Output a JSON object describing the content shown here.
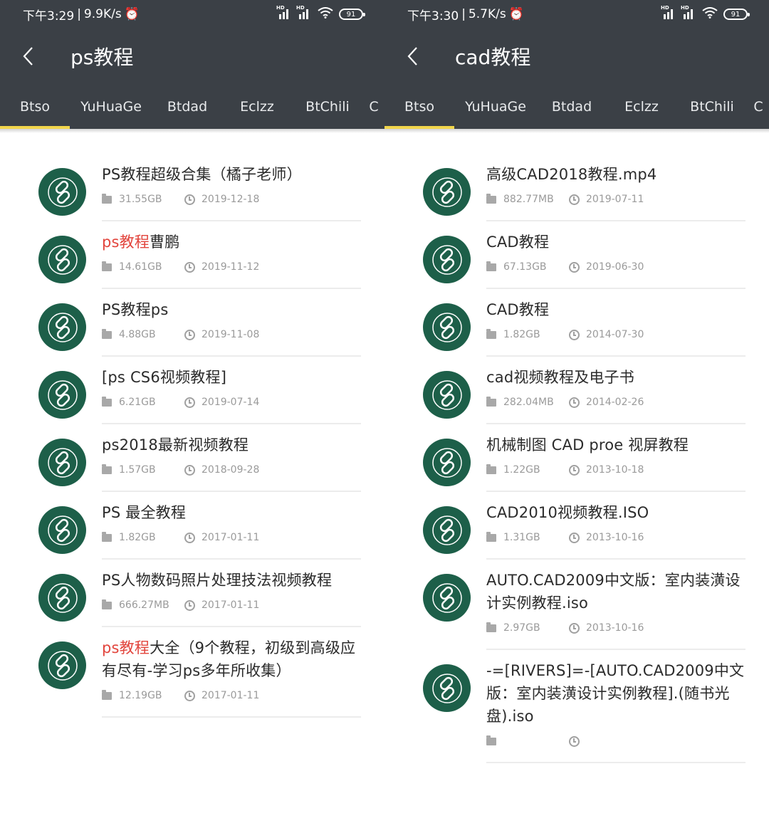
{
  "screens": [
    {
      "status": {
        "time": "下午3:29",
        "speed": "9.9K/s",
        "battery": "91"
      },
      "title": "ps教程",
      "tabs": [
        "Btso",
        "YuHuaGe",
        "Btdad",
        "Eclzz",
        "BtChili",
        "C"
      ],
      "items": [
        {
          "name_pre": "",
          "name_hl": "",
          "name_post": "PS教程超级合集（橘子老师）",
          "size": "31.55GB",
          "date": "2019-12-18"
        },
        {
          "name_pre": "",
          "name_hl": "ps教程",
          "name_post": "曹鹏",
          "size": "14.61GB",
          "date": "2019-11-12"
        },
        {
          "name_pre": "",
          "name_hl": "",
          "name_post": "PS教程ps",
          "size": "4.88GB",
          "date": "2019-11-08"
        },
        {
          "name_pre": "",
          "name_hl": "",
          "name_post": "[ps CS6视频教程]",
          "size": "6.21GB",
          "date": "2019-07-14"
        },
        {
          "name_pre": "",
          "name_hl": "",
          "name_post": "ps2018最新视频教程",
          "size": "1.57GB",
          "date": "2018-09-28"
        },
        {
          "name_pre": "",
          "name_hl": "",
          "name_post": "PS 最全教程",
          "size": "1.82GB",
          "date": "2017-01-11"
        },
        {
          "name_pre": "",
          "name_hl": "",
          "name_post": "PS人物数码照片处理技法视频教程",
          "size": "666.27MB",
          "date": "2017-01-11"
        },
        {
          "name_pre": "",
          "name_hl": "ps教程",
          "name_post": "大全（9个教程，初级到高级应有尽有-学习ps多年所收集）",
          "size": "12.19GB",
          "date": "2017-01-11"
        }
      ]
    },
    {
      "status": {
        "time": "下午3:30",
        "speed": "5.7K/s",
        "battery": "91"
      },
      "title": "cad教程",
      "tabs": [
        "Btso",
        "YuHuaGe",
        "Btdad",
        "Eclzz",
        "BtChili",
        "C"
      ],
      "items": [
        {
          "name_pre": "",
          "name_hl": "",
          "name_post": "高级CAD2018教程.mp4",
          "size": "882.77MB",
          "date": "2019-07-11"
        },
        {
          "name_pre": "",
          "name_hl": "",
          "name_post": "CAD教程",
          "size": "67.13GB",
          "date": "2019-06-30"
        },
        {
          "name_pre": "",
          "name_hl": "",
          "name_post": "CAD教程",
          "size": "1.82GB",
          "date": "2014-07-30"
        },
        {
          "name_pre": "",
          "name_hl": "",
          "name_post": "cad视频教程及电子书",
          "size": "282.04MB",
          "date": "2014-02-26"
        },
        {
          "name_pre": "",
          "name_hl": "",
          "name_post": "机械制图 CAD proe 视屏教程",
          "size": "1.22GB",
          "date": "2013-10-18"
        },
        {
          "name_pre": "",
          "name_hl": "",
          "name_post": "CAD2010视频教程.ISO",
          "size": "1.31GB",
          "date": "2013-10-16"
        },
        {
          "name_pre": "",
          "name_hl": "",
          "name_post": "AUTO.CAD2009中文版：室内装潢设计实例教程.iso",
          "size": "2.97GB",
          "date": "2013-10-16"
        },
        {
          "name_pre": "",
          "name_hl": "",
          "name_post": "-=[RIVERS]=-[AUTO.CAD2009中文版：室内装潢设计实例教程].(随书光盘).iso",
          "size": "",
          "date": ""
        }
      ]
    }
  ]
}
